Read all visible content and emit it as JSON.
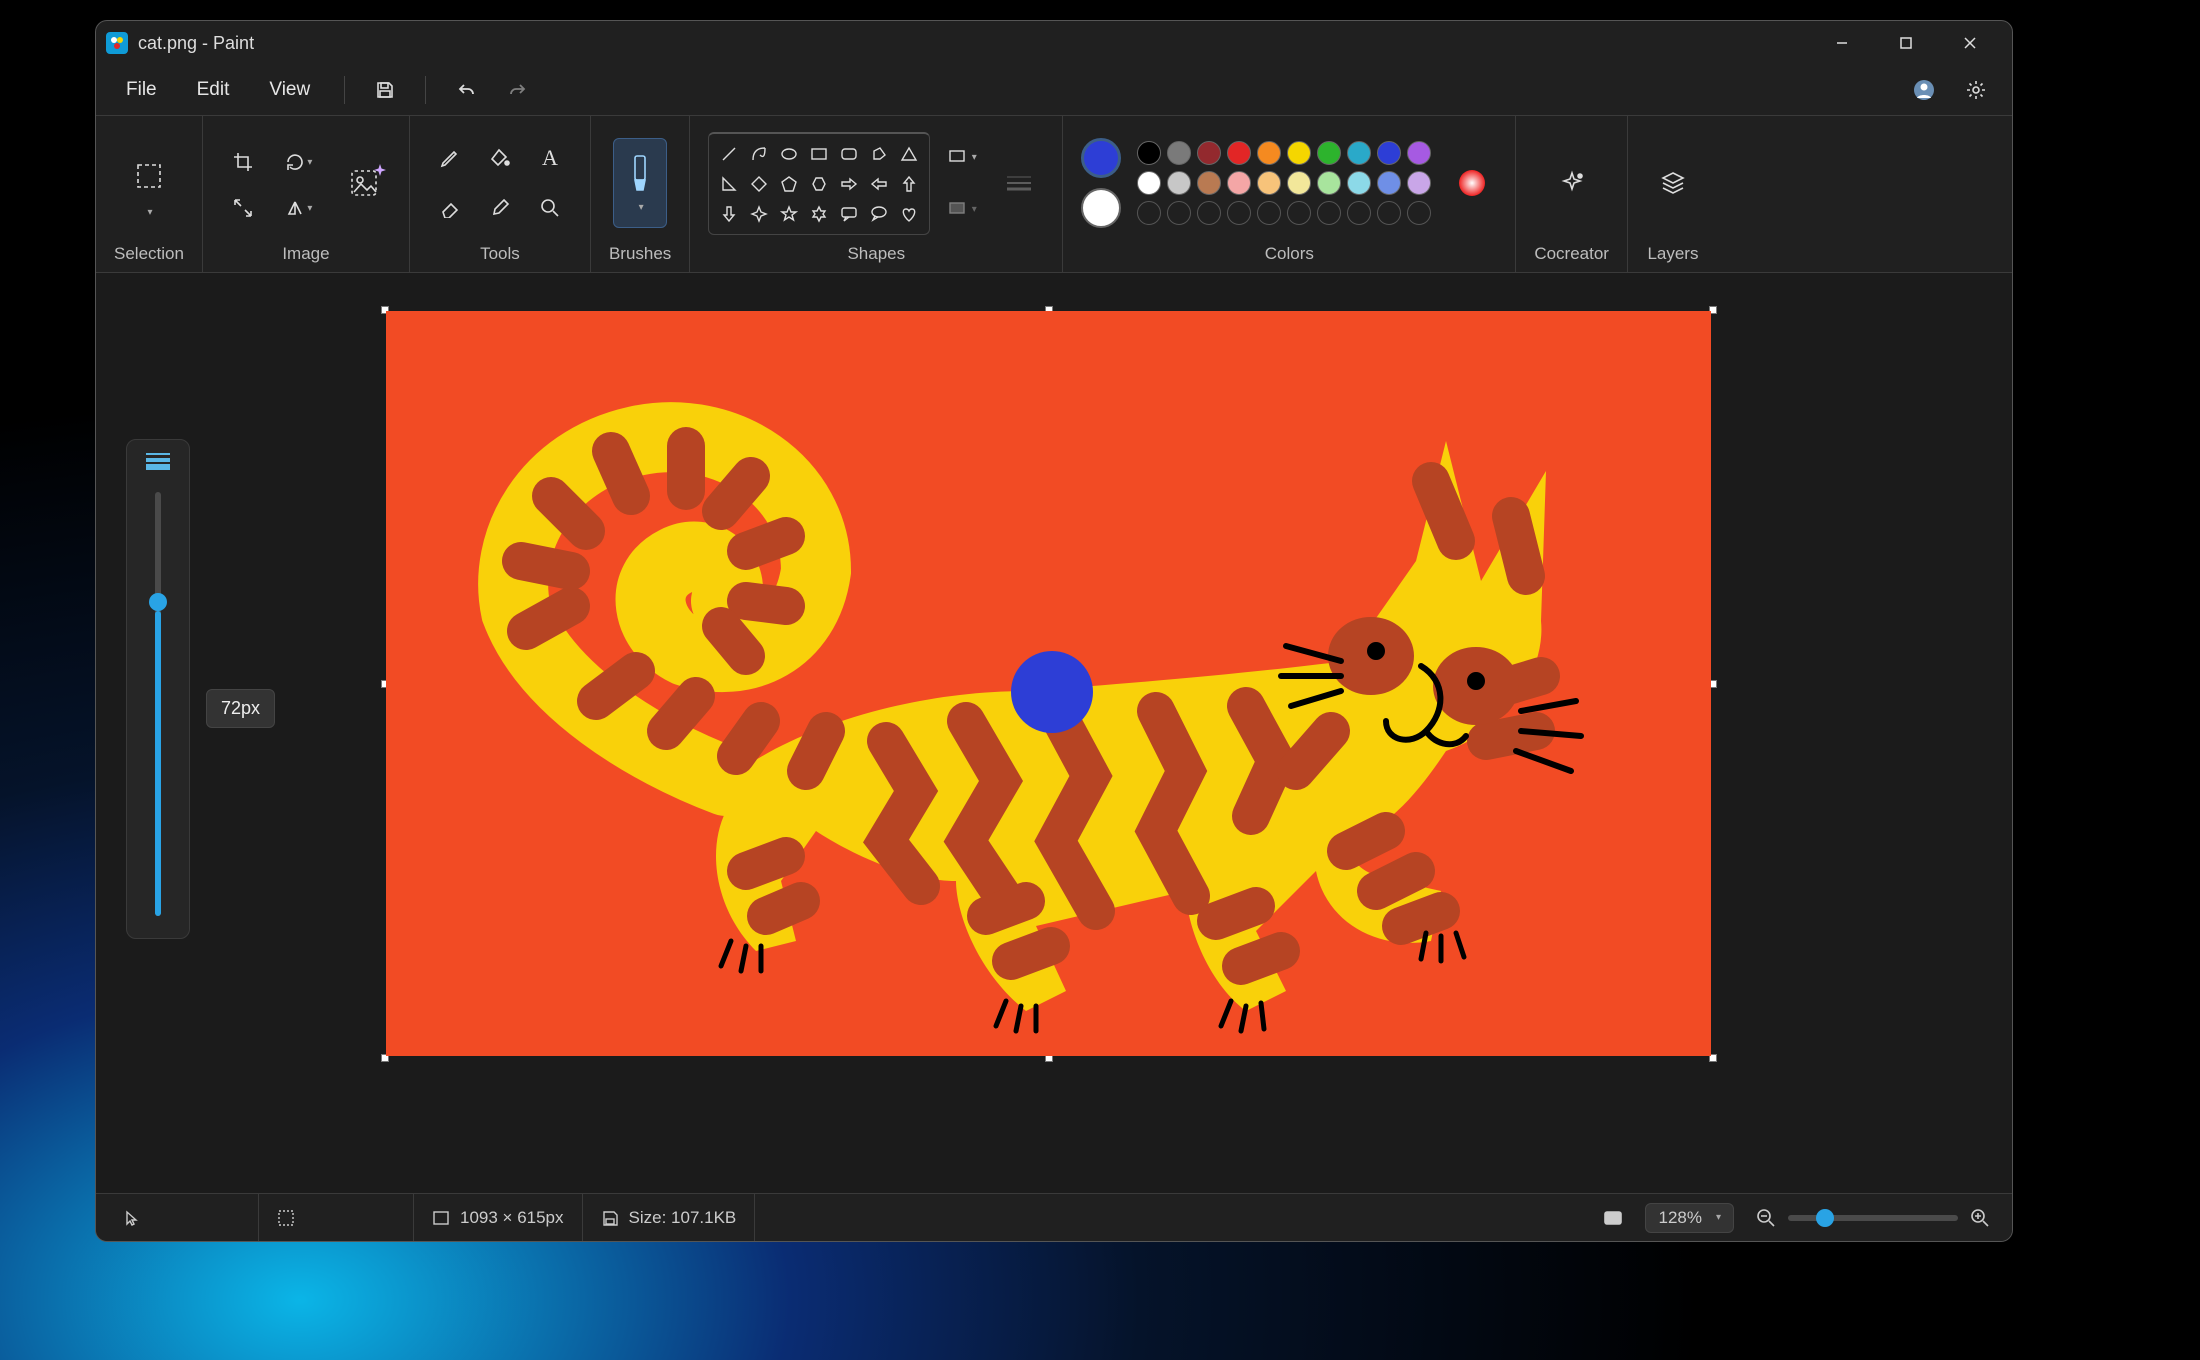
{
  "window": {
    "title": "cat.png - Paint"
  },
  "menu": {
    "file": "File",
    "edit": "Edit",
    "view": "View"
  },
  "ribbon": {
    "selection": "Selection",
    "image": "Image",
    "tools": "Tools",
    "brushes": "Brushes",
    "shapes": "Shapes",
    "colors": "Colors",
    "cocreator": "Cocreator",
    "layers": "Layers"
  },
  "colors": {
    "primary": "#2d3ed6",
    "secondary": "#ffffff",
    "row1": [
      "#000000",
      "#7a7a7a",
      "#93292e",
      "#e22626",
      "#f58a20",
      "#f5d600",
      "#2db32d",
      "#2aa9c9",
      "#2d3ed6",
      "#a65ae2"
    ],
    "row2": [
      "#ffffff",
      "#c7c7c7",
      "#b97a52",
      "#f4a6a6",
      "#f7c37a",
      "#f2e79a",
      "#a8e49d",
      "#8cd9e8",
      "#6f8fe6",
      "#c9a6e8"
    ],
    "customSlots": 10
  },
  "brush": {
    "sizeLabel": "72px",
    "sizeValue": 72,
    "sizeMax": 100
  },
  "status": {
    "dimensions": "1093 × 615px",
    "fileSize": "Size: 107.1KB",
    "zoom": "128%"
  },
  "artwork": {
    "bg": "#f24b24",
    "cat_body": "#f9d10a",
    "cat_stripe": "#b64423",
    "brush_dot": "#2d3ed6"
  }
}
